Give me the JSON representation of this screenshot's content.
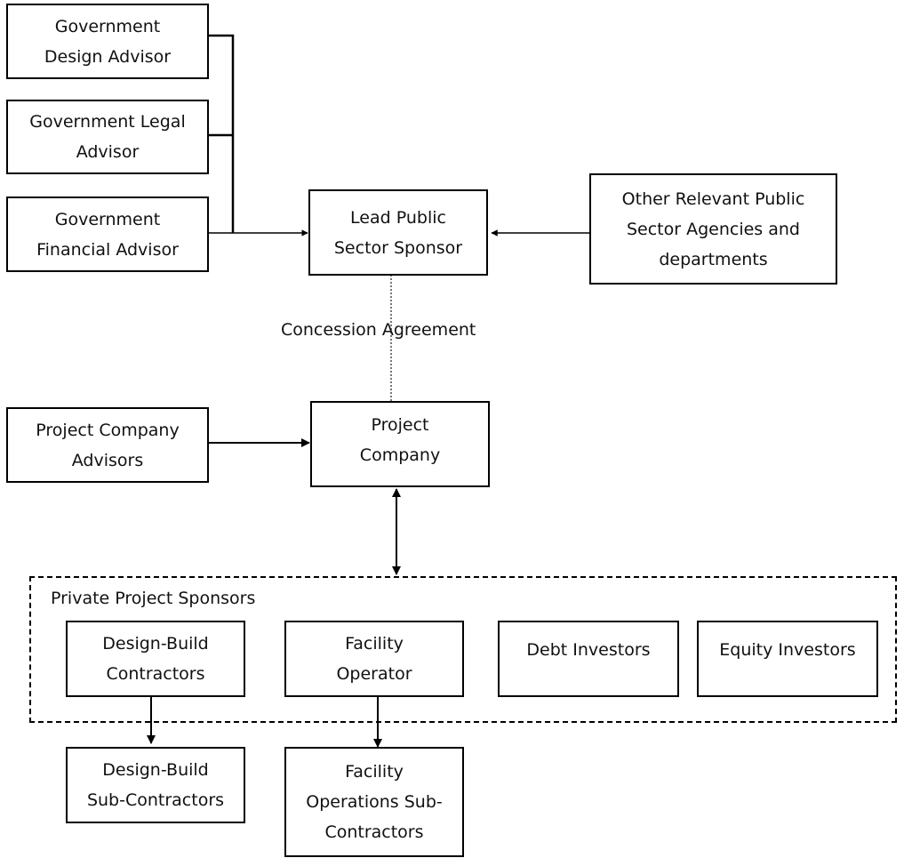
{
  "nodes": {
    "gov_design": "Government Design Advisor",
    "gov_legal": "Government Legal Advisor",
    "gov_financial": "Government Financial Advisor",
    "lead_public": "Lead Public Sector Sponsor",
    "other_public": "Other Relevant Public Sector Agencies and departments",
    "pc_advisors": "Project Company Advisors",
    "project_company": "Project Company",
    "db_contractors": "Design-Build Contractors",
    "facility_operator": "Facility Operator",
    "debt_investors": "Debt Investors",
    "equity_investors": "Equity Investors",
    "db_subcontractors": "Design-Build Sub-Contractors",
    "fo_subcontractors": "Facility Operations Sub-Contractors"
  },
  "lines": {
    "gov_design": [
      "Government",
      "Design Advisor"
    ],
    "gov_legal": [
      "Government Legal",
      "Advisor"
    ],
    "gov_financial": [
      "Government",
      "Financial Advisor"
    ],
    "lead_public": [
      "Lead Public",
      "Sector Sponsor"
    ],
    "other_public": [
      "Other Relevant Public",
      "Sector Agencies and",
      "departments"
    ],
    "pc_advisors": [
      "Project Company",
      "Advisors"
    ],
    "project_company": [
      "Project",
      "Company"
    ],
    "db_contractors": [
      "Design-Build",
      "Contractors"
    ],
    "facility_operator": [
      "Facility",
      "Operator"
    ],
    "debt_investors": [
      "Debt Investors"
    ],
    "equity_investors": [
      "Equity Investors"
    ],
    "db_subcontractors": [
      "Design-Build",
      "Sub-Contractors"
    ],
    "fo_subcontractors": [
      "Facility",
      "Operations Sub-",
      "Contractors"
    ]
  },
  "group": {
    "label": "Private Project Sponsors"
  },
  "edges": {
    "concession_label": "Concession Agreement"
  }
}
